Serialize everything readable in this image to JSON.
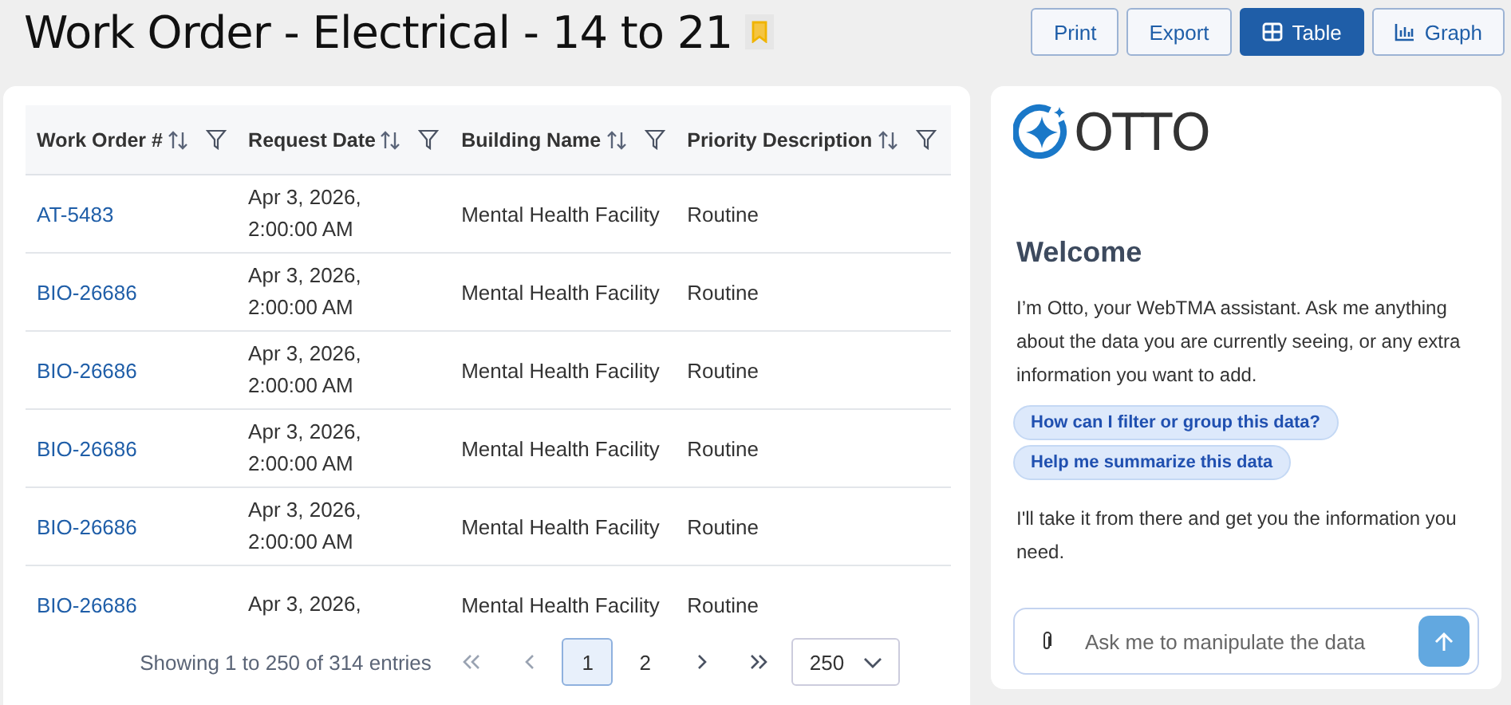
{
  "header": {
    "title": "Work Order - Electrical - 14 to 21",
    "bookmarked": true,
    "buttons": [
      {
        "label": "Print",
        "kind": "plain",
        "selected": false
      },
      {
        "label": "Export",
        "kind": "plain",
        "selected": false
      },
      {
        "label": "Table",
        "kind": "table",
        "selected": true
      },
      {
        "label": "Graph",
        "kind": "graph",
        "selected": false
      }
    ]
  },
  "table": {
    "columns": [
      "Work Order #",
      "Request Date",
      "Building Name",
      "Priority Description"
    ],
    "rows": [
      {
        "work_order": "AT-5483",
        "date": [
          "Apr 3, 2026,",
          "2:00:00 AM"
        ],
        "building": "Mental Health Facility",
        "priority": "Routine"
      },
      {
        "work_order": "BIO-26686",
        "date": [
          "Apr 3, 2026,",
          "2:00:00 AM"
        ],
        "building": "Mental Health Facility",
        "priority": "Routine"
      },
      {
        "work_order": "BIO-26686",
        "date": [
          "Apr 3, 2026,",
          "2:00:00 AM"
        ],
        "building": "Mental Health Facility",
        "priority": "Routine"
      },
      {
        "work_order": "BIO-26686",
        "date": [
          "Apr 3, 2026,",
          "2:00:00 AM"
        ],
        "building": "Mental Health Facility",
        "priority": "Routine"
      },
      {
        "work_order": "BIO-26686",
        "date": [
          "Apr 3, 2026,",
          "2:00:00 AM"
        ],
        "building": "Mental Health Facility",
        "priority": "Routine"
      },
      {
        "work_order": "BIO-26686",
        "date": [
          "Apr 3, 2026,"
        ],
        "building": "Mental Health Facility",
        "priority": "Routine"
      }
    ]
  },
  "pagination": {
    "summary": "Showing 1 to 250 of 314 entries",
    "pages": [
      {
        "label": "1",
        "selected": true
      },
      {
        "label": "2",
        "selected": false
      }
    ],
    "page_size": "250"
  },
  "assistant": {
    "logo": "OTTO",
    "heading": "Welcome",
    "intro": "I’m Otto, your WebTMA assistant. Ask me anything about the data you are currently seeing, or any extra information you want to add.",
    "suggestions": [
      "How can I filter or group this data?",
      "Help me summarize this data"
    ],
    "outro": "I'll take it from there and get you the information you need.",
    "input": {
      "placeholder": "Ask me to manipulate the data"
    }
  }
}
